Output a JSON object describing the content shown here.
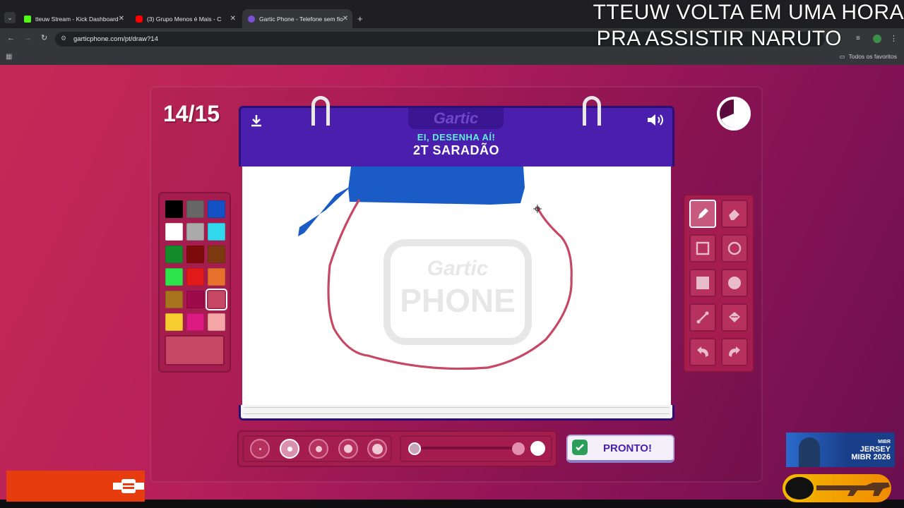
{
  "browser": {
    "tabs": [
      {
        "label": "tteuw Stream - Kick Dashboard",
        "icon": "kick-icon",
        "color": "#53fc18"
      },
      {
        "label": "(3) Grupo Menos é Mais - C",
        "icon": "youtube-icon",
        "color": "#ff0000"
      },
      {
        "label": "Gartic Phone - Telefone sem fio",
        "icon": "gartic-icon",
        "color": "#7b4fd6"
      }
    ],
    "url": "garticphone.com/pt/draw?14",
    "bookmarks_label": "Todos os favoritos"
  },
  "stream_overlay": {
    "line1": "TTEUW VOLTA EM UMA HORA",
    "line2": "PRA ASSISTIR NARUTO"
  },
  "game": {
    "turn": "14/15",
    "logo": "Gartic",
    "prompt_label": "EI, DESENHA AÍ!",
    "word": "2T SARADÃO",
    "watermark_top": "Gartic",
    "watermark_bottom": "PHONE",
    "done_button": "PRONTO!",
    "selected_color": "#c64865",
    "palette": [
      "#000000",
      "#666666",
      "#1252c4",
      "#ffffff",
      "#aaaaaa",
      "#32d8ec",
      "#138c2c",
      "#7e0b0b",
      "#7d3a10",
      "#2ee24a",
      "#e21919",
      "#e6722d",
      "#a8741d",
      "#9e0a4a",
      "#c64865",
      "#f7cc30",
      "#dd1a82",
      "#f4a6a6"
    ],
    "tools": [
      "pencil-icon",
      "eraser-icon",
      "rect-outline-icon",
      "circle-outline-icon",
      "rect-fill-icon",
      "circle-fill-icon",
      "line-icon",
      "fill-bucket-icon",
      "undo-icon",
      "redo-icon"
    ],
    "brush_sizes": 5,
    "selected_brush": 2
  },
  "ad": {
    "brand": "MIBR",
    "line1": "JERSEY",
    "line2": "MIBR 2026"
  }
}
